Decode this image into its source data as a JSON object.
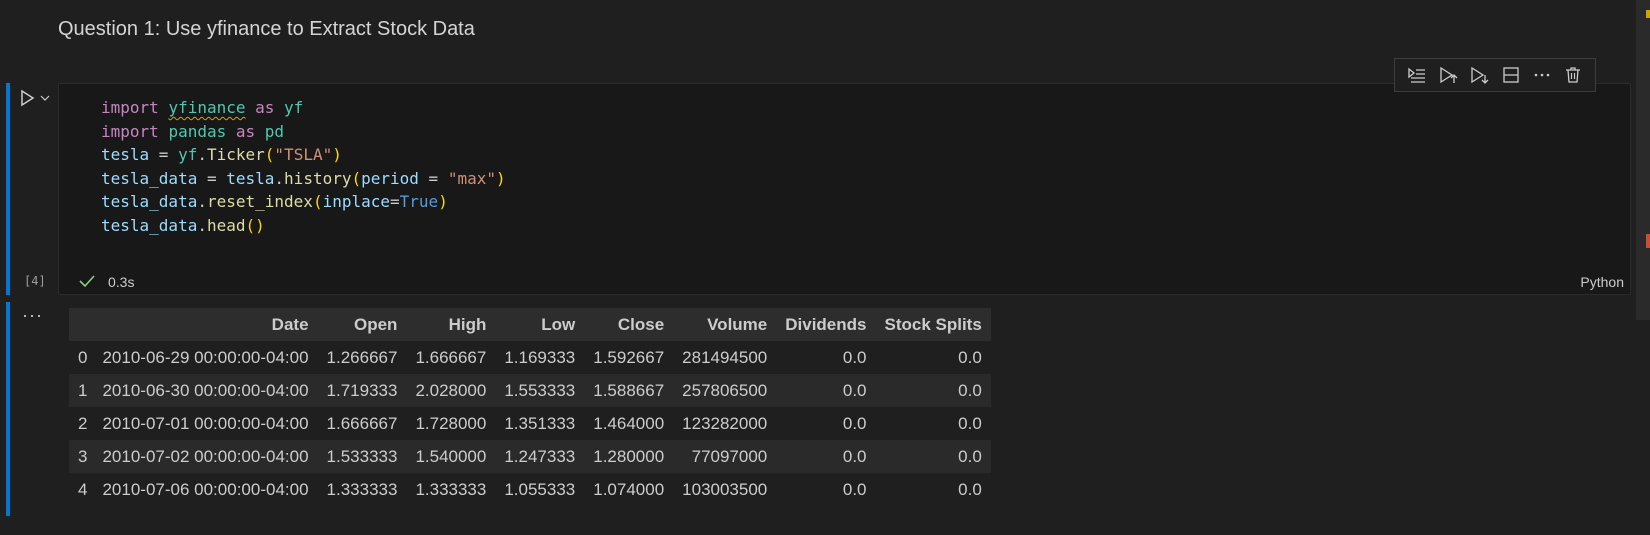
{
  "markdown": {
    "heading": "Question 1: Use yfinance to Extract Stock Data"
  },
  "cell": {
    "execution_count": "[4]",
    "duration": "0.3s",
    "language": "Python",
    "status": "success",
    "code_lines": [
      "import yfinance as yf",
      "import pandas as pd",
      "tesla = yf.Ticker(\"TSLA\")",
      "tesla_data = tesla.history(period = \"max\")",
      "tesla_data.reset_index(inplace=True)",
      "tesla_data.head()"
    ]
  },
  "toolbar": {
    "buttons": [
      "execute-above-icon",
      "execute-below-icon",
      "run-next-icon",
      "split-cell-icon",
      "more-icon",
      "delete-icon"
    ]
  },
  "output": {
    "more_label": "···",
    "columns": [
      "",
      "Date",
      "Open",
      "High",
      "Low",
      "Close",
      "Volume",
      "Dividends",
      "Stock Splits"
    ],
    "rows": [
      [
        "0",
        "2010-06-29 00:00:00-04:00",
        "1.266667",
        "1.666667",
        "1.169333",
        "1.592667",
        "281494500",
        "0.0",
        "0.0"
      ],
      [
        "1",
        "2010-06-30 00:00:00-04:00",
        "1.719333",
        "2.028000",
        "1.553333",
        "1.588667",
        "257806500",
        "0.0",
        "0.0"
      ],
      [
        "2",
        "2010-07-01 00:00:00-04:00",
        "1.666667",
        "1.728000",
        "1.351333",
        "1.464000",
        "123282000",
        "0.0",
        "0.0"
      ],
      [
        "3",
        "2010-07-02 00:00:00-04:00",
        "1.533333",
        "1.540000",
        "1.247333",
        "1.280000",
        "77097000",
        "0.0",
        "0.0"
      ],
      [
        "4",
        "2010-07-06 00:00:00-04:00",
        "1.333333",
        "1.333333",
        "1.055333",
        "1.074000",
        "103003500",
        "0.0",
        "0.0"
      ]
    ]
  },
  "colors": {
    "accent": "#0078d4",
    "success": "#89d185"
  }
}
